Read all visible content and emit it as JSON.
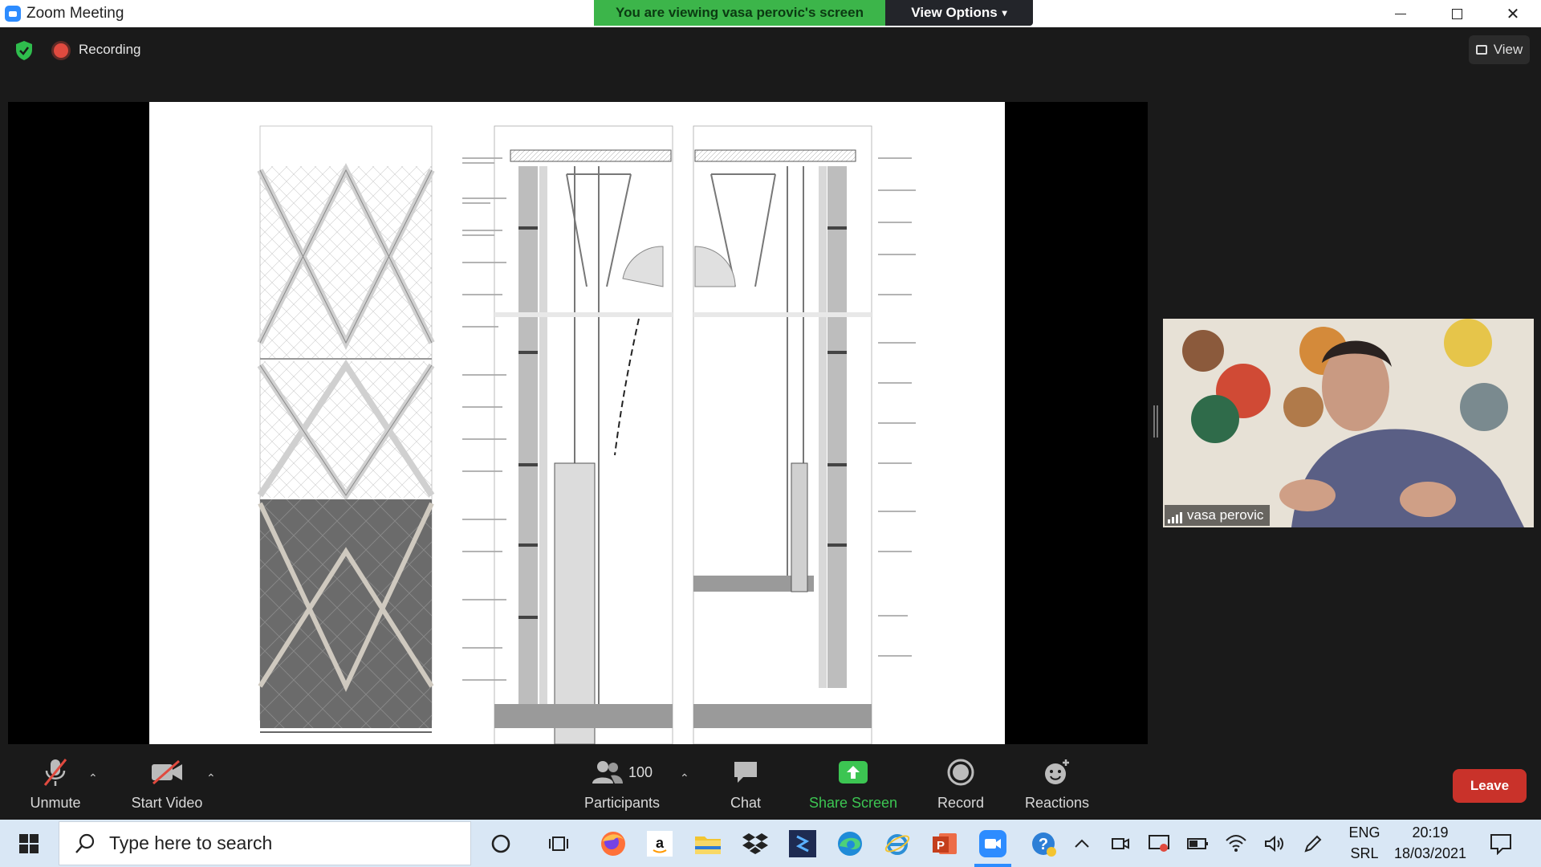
{
  "window": {
    "title": "Zoom Meeting"
  },
  "banner": {
    "viewing": "You are viewing vasa perovic's screen",
    "view_options": "View Options"
  },
  "meeting": {
    "recording_label": "Recording",
    "view_label": "View"
  },
  "video": {
    "participant_name": "vasa perovic"
  },
  "toolbar": {
    "unmute": "Unmute",
    "start_video": "Start Video",
    "participants": "Participants",
    "participant_count": "100",
    "chat": "Chat",
    "share_screen": "Share Screen",
    "record": "Record",
    "reactions": "Reactions",
    "leave": "Leave"
  },
  "taskbar": {
    "search_placeholder": "Type here to search",
    "language": "ENG",
    "layout": "SRL",
    "time": "20:19",
    "date": "18/03/2021"
  },
  "colors": {
    "accent_green": "#3cb54a",
    "zoom_blue": "#2d8cff",
    "leave_red": "#c9322a"
  },
  "icons": [
    "zoom-icon",
    "shield-icon",
    "recording-icon",
    "microphone-muted-icon",
    "video-off-icon",
    "participants-icon",
    "chat-icon",
    "share-screen-icon",
    "record-icon",
    "reactions-icon",
    "windows-start-icon",
    "search-icon",
    "cortana-icon",
    "task-view-icon",
    "firefox-icon",
    "amazon-icon",
    "file-explorer-icon",
    "dropbox-icon",
    "app-icon",
    "edge-icon",
    "internet-explorer-icon",
    "powerpoint-icon",
    "zoom-taskbar-icon",
    "help-icon",
    "chevron-up-icon",
    "meet-icon",
    "battery-icon",
    "wifi-icon",
    "volume-icon",
    "pen-icon",
    "notification-icon"
  ]
}
